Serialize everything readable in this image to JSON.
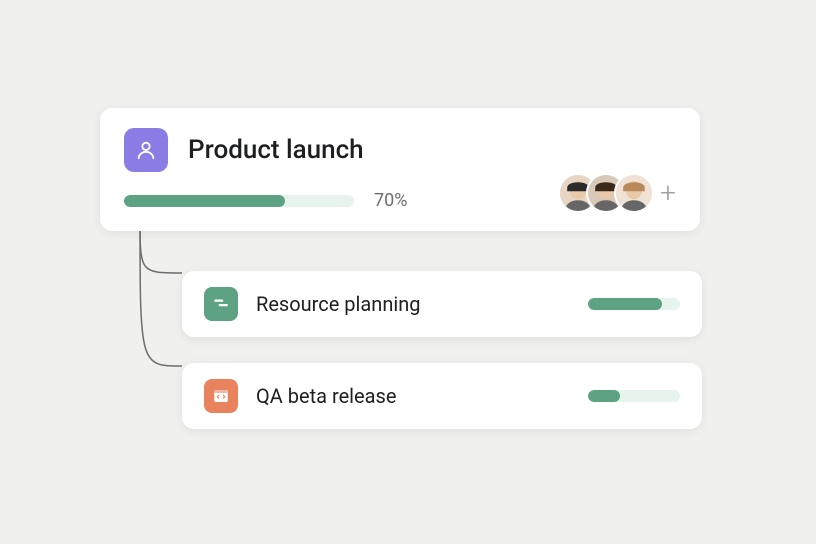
{
  "parent": {
    "title": "Product launch",
    "progress_percent": 70,
    "percent_label": "70%",
    "icon_bg": "#8a7ee6",
    "avatars": [
      {
        "bg": "#e8d5c4",
        "hair": "#2b2b2b"
      },
      {
        "bg": "#d9c9b8",
        "hair": "#3a2a1a"
      },
      {
        "bg": "#f0e2d4",
        "hair": "#b88a5a"
      }
    ]
  },
  "children": [
    {
      "title": "Resource planning",
      "icon_bg": "#5da283",
      "icon": "list",
      "progress_percent": 80
    },
    {
      "title": "QA beta release",
      "icon_bg": "#e9835e",
      "icon": "code",
      "progress_percent": 35
    }
  ]
}
